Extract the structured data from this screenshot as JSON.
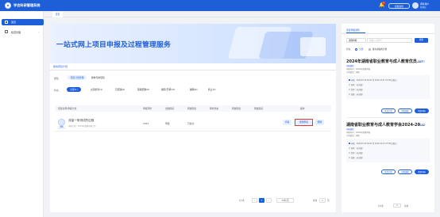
{
  "app": {
    "title": "学会科研管理系统"
  },
  "header": {
    "notify_count": "1",
    "switch_label": "切换身份",
    "user_name": "审核用户",
    "user_role": "管理员"
  },
  "sidebar": {
    "items": [
      {
        "label": "首页"
      },
      {
        "label": "检查管理"
      }
    ]
  },
  "tabs": [
    {
      "label": "首页"
    }
  ],
  "banner": {
    "title": "一站式网上项目申报及过程管理服务"
  },
  "section": {
    "tab_label": "我的项目计划"
  },
  "filters": {
    "type_label": "类型：",
    "type_options": [
      "项目计划管理",
      "我参与的项目"
    ],
    "status_label": "状态：",
    "status_options": [
      "全部(1)",
      "立项检查(1)",
      "已结题(0)",
      "延期结题(0)",
      "撤项(已审)(0)",
      "撤销(0)",
      "终止(0)"
    ]
  },
  "table": {
    "headers": [
      "项目名称/申报计划",
      "申报年份",
      "当前阶段",
      "所属阶段",
      "审查状态",
      "所属阶段",
      "所属阶段",
      "操作"
    ],
    "rows": [
      {
        "badge": "课题",
        "title": "流量一条测试的过程",
        "subtitle": "申报计划：2024年课题申报工作",
        "year": "2024",
        "stage": "申报",
        "review": "已提交",
        "status": "已提交",
        "actions": [
          "查看",
          "课题申报",
          "删除"
        ]
      }
    ]
  },
  "pagination": {
    "total": "共1条",
    "page_size": "10条/页",
    "current": "1",
    "goto_label": "前往",
    "goto_value": "1",
    "page_unit": "页"
  },
  "right_panel": {
    "title": "项目申报通知",
    "select_value": "课题申报",
    "search_placeholder": "请输入关键词",
    "search_button": "搜索",
    "filter_label": "状态：",
    "filter_options": [
      "全部",
      "我可参加的计划"
    ],
    "cards": [
      {
        "title": "2024年湖南省职业教育与成人教育优员...",
        "tag": "申报通知",
        "meta1": "申报时间：2024年课题申报",
        "meta2": "计划类别：湖南",
        "timeline": [
          "申报：2024-03-10 00:00 至 2024-03-31 23:59(已截止)",
          "初审：(未开始)",
          "复审：(未开始)",
          "结果：(未开始)"
        ],
        "buttons": [
          "项目计划",
          "查看通知",
          "我要申报"
        ],
        "side": "申报截止"
      },
      {
        "title": "湖南省职业教育与成人教育学会2024-20...",
        "tag": "申报通知",
        "meta1": "申报时间：2024年课题申报",
        "meta2": "计划类别：湖南",
        "timeline": [
          "申报：2024-03-20 00:00 至 2024-04-10 23:59(已截止)",
          "初审：(未开始)",
          "复审：(未开始)",
          "结果：(未开始)"
        ],
        "buttons": [
          "项目计划",
          "查看通知",
          "我要申报"
        ],
        "side": "正在申报"
      }
    ],
    "pagination": {
      "total": "共2条",
      "page": "1",
      "goto": "前往"
    }
  },
  "colors": {
    "brand": "#1e5fd8",
    "highlight": "#e53935"
  }
}
